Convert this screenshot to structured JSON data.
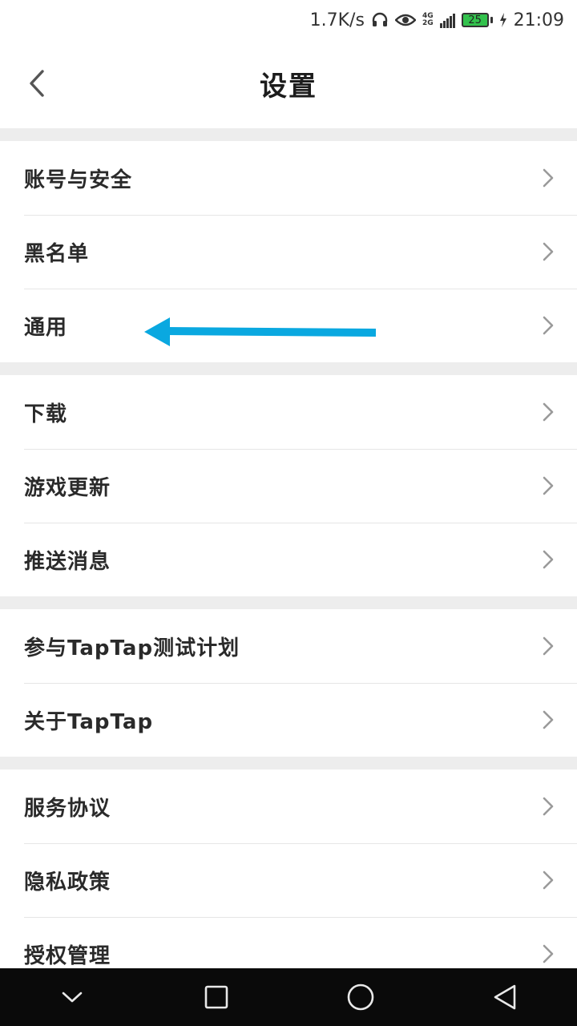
{
  "status_bar": {
    "net_speed": "1.7K/s",
    "net_type_top": "4G",
    "net_type_bottom": "2G",
    "battery": "25",
    "time": "21:09",
    "icons": [
      "headphones-icon",
      "eye-icon",
      "signal-icon",
      "charging-icon"
    ],
    "battery_color": "#33c24d"
  },
  "header": {
    "title": "设置",
    "back_icon": "chevron-left-icon"
  },
  "groups": [
    {
      "items": [
        {
          "label": "账号与安全"
        },
        {
          "label": "黑名单"
        },
        {
          "label": "通用"
        }
      ]
    },
    {
      "items": [
        {
          "label": "下载"
        },
        {
          "label": "游戏更新"
        },
        {
          "label": "推送消息"
        }
      ]
    },
    {
      "items": [
        {
          "label": "参与TapTap测试计划"
        },
        {
          "label": "关于TapTap"
        }
      ]
    },
    {
      "items": [
        {
          "label": "服务协议"
        },
        {
          "label": "隐私政策"
        },
        {
          "label": "授权管理"
        }
      ]
    }
  ],
  "annotation": {
    "color": "#0aa8e0",
    "target": "通用"
  },
  "nav_bar": {
    "buttons": [
      "chevron-down-icon",
      "square-icon",
      "circle-icon",
      "triangle-back-icon"
    ]
  },
  "colors": {
    "divider": "#e6e6e6",
    "group_gap": "#ededed",
    "text": "#2a2a2a",
    "chevron": "#9a9a9a"
  }
}
